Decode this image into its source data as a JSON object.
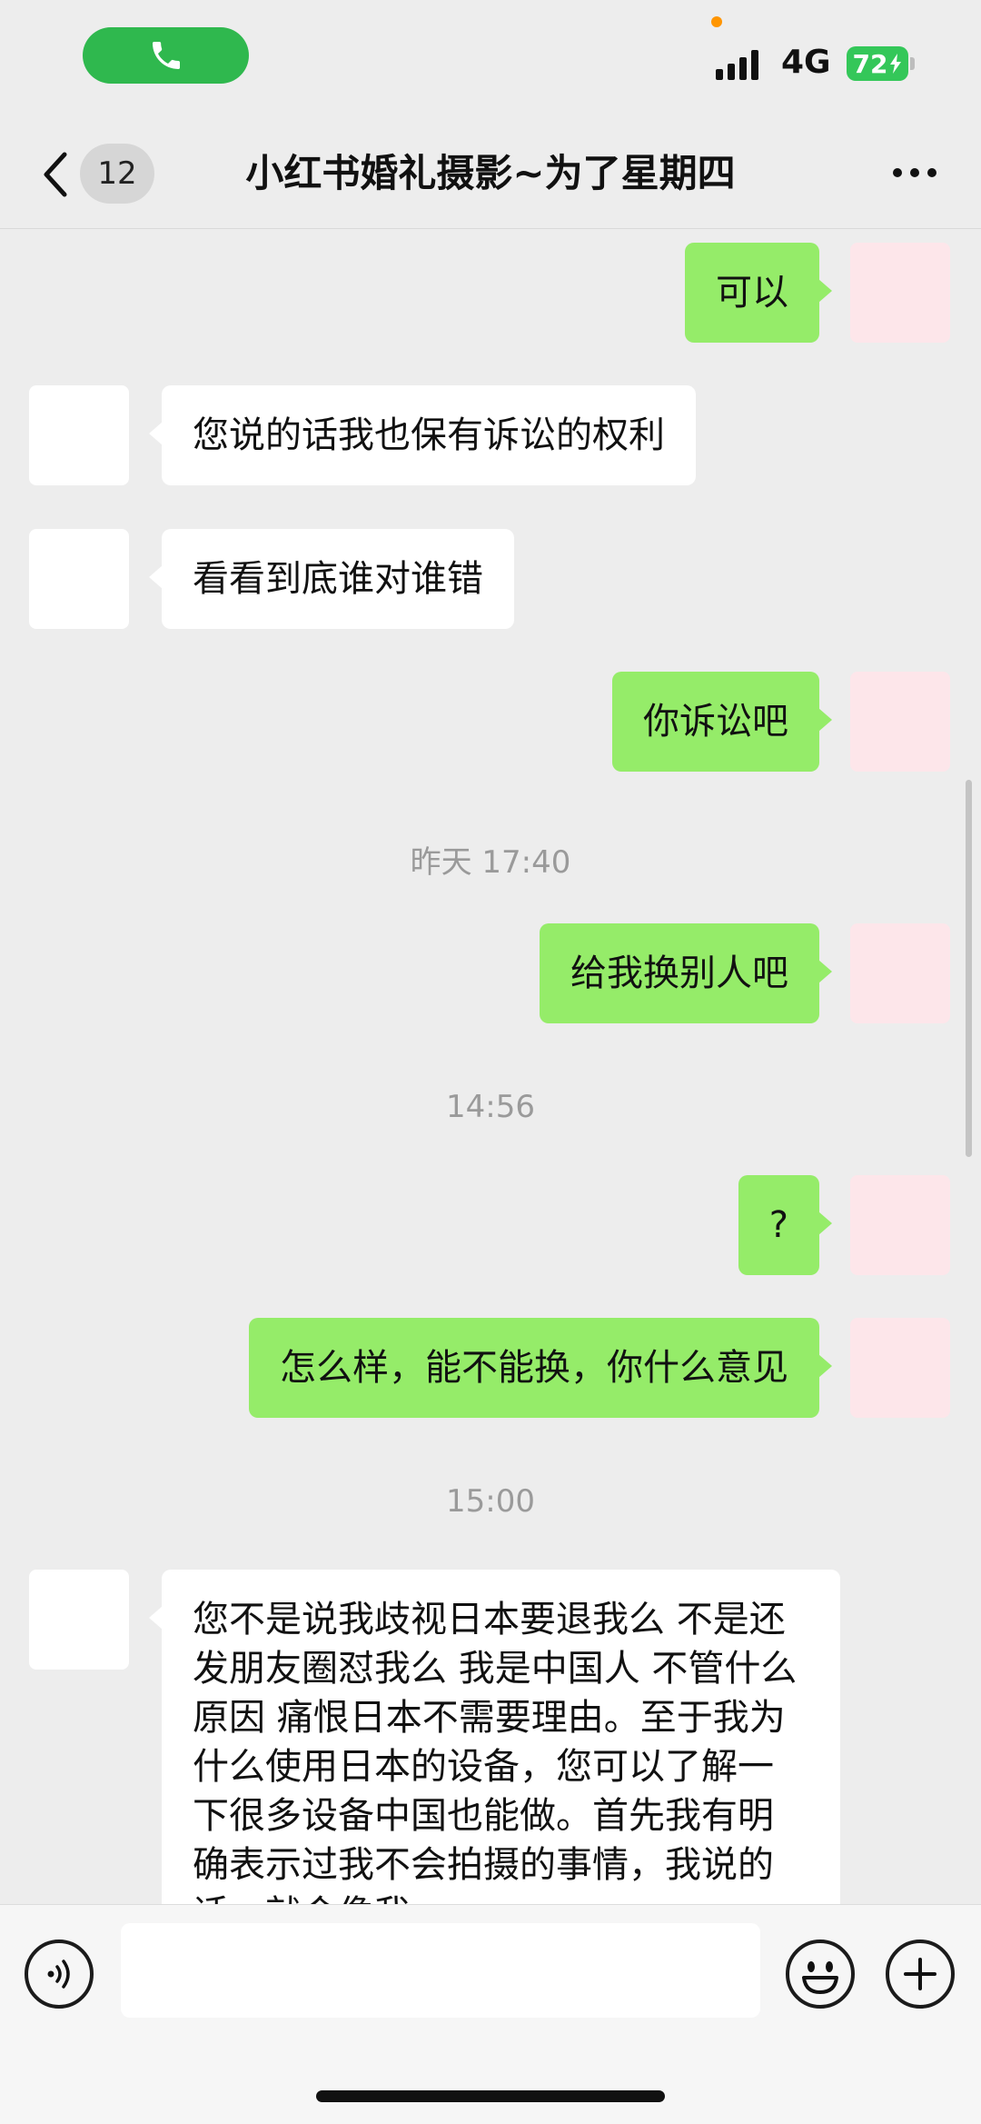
{
  "status_bar": {
    "network": "4G",
    "battery": "72"
  },
  "nav": {
    "unread_count": "12",
    "title": "小红书婚礼摄影~为了星期四"
  },
  "messages": [
    {
      "side": "me",
      "text": "可以"
    },
    {
      "side": "peer",
      "text": "您说的话我也保有诉讼的权利"
    },
    {
      "side": "peer",
      "text": "看看到底谁对谁错"
    },
    {
      "side": "me",
      "text": "你诉讼吧"
    },
    {
      "type": "timestamp",
      "text": "昨天 17:40"
    },
    {
      "side": "me",
      "text": "给我换别人吧"
    },
    {
      "type": "timestamp",
      "text": "14:56"
    },
    {
      "side": "me",
      "text": "?"
    },
    {
      "side": "me",
      "text": "怎么样，能不能换，你什么意见"
    },
    {
      "type": "timestamp",
      "text": "15:00"
    },
    {
      "side": "peer",
      "text": "您不是说我歧视日本要退我么  不是还发朋友圈怼我么   我是中国人  不管什么原因 痛恨日本不需要理由。至于我为什么使用日本的设备，您可以了解一下很多设备中国也能做。首先我有明确表示过我不会拍摄的事情，我说的话，就会像我"
    }
  ],
  "input_bar": {
    "placeholder": ""
  },
  "colors": {
    "my_bubble": "#95ec69",
    "peer_bubble": "#ffffff",
    "background": "#ededed",
    "call_pill": "#2fb84e",
    "battery": "#34c759"
  },
  "icons": [
    "phone-icon",
    "back-chevron-icon",
    "more-dots-icon",
    "voice-icon",
    "emoji-icon",
    "plus-icon"
  ]
}
